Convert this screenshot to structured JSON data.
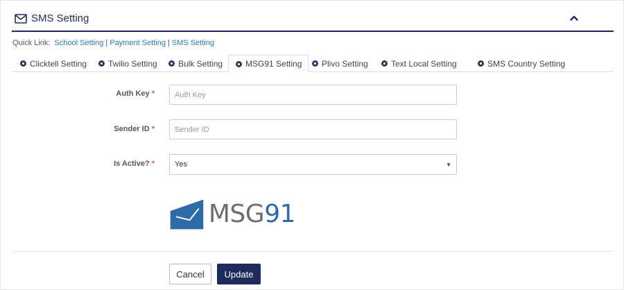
{
  "header": {
    "title": "SMS Setting",
    "title_icon": "envelope-icon",
    "collapse_icon": "chevron-up-icon"
  },
  "quick_links": {
    "label": "Quick Link:",
    "links": [
      "School Setting",
      "Payment Setting",
      "SMS Setting"
    ],
    "separator": "|"
  },
  "tabs": [
    {
      "label": "Clicktell Setting",
      "icon": "gear-icon",
      "active": false
    },
    {
      "label": "Twilio Setting",
      "icon": "gear-icon",
      "active": false
    },
    {
      "label": "Bulk Setting",
      "icon": "gear-icon",
      "active": false
    },
    {
      "label": "MSG91 Setting",
      "icon": "gear-icon",
      "active": true
    },
    {
      "label": "Plivo Setting",
      "icon": "gear-icon",
      "active": false
    },
    {
      "label": "Text Local Setting",
      "icon": "gear-icon",
      "active": false
    },
    {
      "label": "SMS Country Setting",
      "icon": "gear-icon",
      "active": false
    }
  ],
  "form": {
    "auth_key": {
      "label": "Auth Key",
      "required": "*",
      "placeholder": "Auth Key",
      "value": ""
    },
    "sender_id": {
      "label": "Sender ID",
      "required": "*",
      "placeholder": "Sender ID",
      "value": ""
    },
    "is_active": {
      "label": "Is Active?",
      "required": "*",
      "value": "Yes"
    }
  },
  "logo": {
    "text_main": "MSG",
    "text_num": "91",
    "brand_blue": "#2f6aa8"
  },
  "buttons": {
    "cancel": "Cancel",
    "update": "Update"
  },
  "colors": {
    "primary": "#1e2b5c",
    "link": "#2a7ab8",
    "required": "#d9534f"
  }
}
